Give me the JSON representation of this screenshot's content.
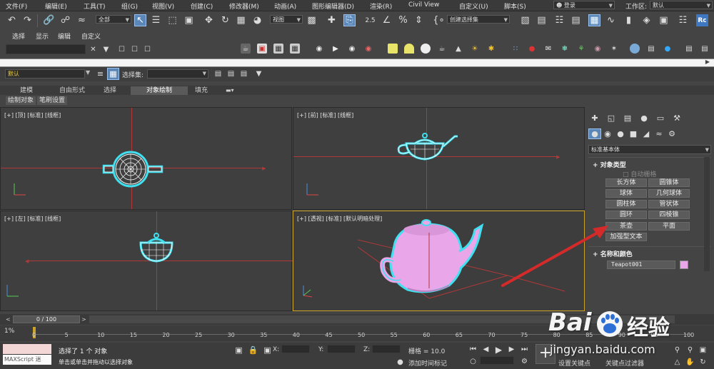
{
  "menu": {
    "items": [
      "文件(F)",
      "编辑(E)",
      "工具(T)",
      "组(G)",
      "视图(V)",
      "创建(C)",
      "修改器(M)",
      "动画(A)",
      "图形编辑器(D)",
      "渲染(R)",
      "Civil View",
      "自定义(U)",
      "脚本(S)"
    ],
    "login": "登录",
    "workspace_label": "工作区:",
    "workspace_value": "默认"
  },
  "toolbar": {
    "filter_value": "全部",
    "view_value": "视图",
    "selection_set_placeholder": "创建选择集",
    "snap_labels": [
      "2",
      "2.5"
    ]
  },
  "submenu": {
    "items": [
      "选择",
      "显示",
      "编辑",
      "自定义"
    ]
  },
  "layer": {
    "name": "默认",
    "selection_set_label": "选择集:"
  },
  "ribbon": {
    "tabs": [
      "建模",
      "自由形式",
      "选择",
      "对象绘制",
      "填充"
    ],
    "active_tab": "对象绘制",
    "subtabs": [
      "绘制对象",
      "笔刷设置"
    ]
  },
  "viewports": [
    {
      "label": "[+] [顶] [标准] [线框]"
    },
    {
      "label": "[+] [前] [标准] [线框]"
    },
    {
      "label": "[+] [左] [标准] [线框]"
    },
    {
      "label": "[+] [透视] [标准] [默认明暗处理]"
    }
  ],
  "command_panel": {
    "category": "标准基本体",
    "object_type_title": "对象类型",
    "autogrid_label": "自动栅格",
    "buttons": [
      [
        "长方体",
        "圆锥体"
      ],
      [
        "球体",
        "几何球体"
      ],
      [
        "圆柱体",
        "管状体"
      ],
      [
        "圆环",
        "四棱锥"
      ],
      [
        "茶壶",
        "平面"
      ]
    ],
    "extra_button": "加强型文本",
    "name_color_title": "名称和颜色",
    "object_name": "Teapot001",
    "object_color": "#e9a6e8"
  },
  "timeline": {
    "frame_display": "0 / 100",
    "ticks": [
      "0",
      "5",
      "10",
      "15",
      "20",
      "25",
      "30",
      "35",
      "40",
      "45",
      "50",
      "55",
      "60",
      "65",
      "70",
      "75",
      "80",
      "85",
      "90",
      "95",
      "100"
    ]
  },
  "status": {
    "script_label": "MAXScript 迷",
    "selected_text": "选择了 1 个 对象",
    "hint_text": "单击或单击并拖动以选择对象",
    "x_label": "X:",
    "y_label": "Y:",
    "z_label": "Z:",
    "grid_label": "栅格 = 10.0",
    "add_time_tag": "添加时间标记",
    "set_key": "设置关键点",
    "key_filter": "关键点过滤器"
  },
  "watermark": {
    "brand": "Bai",
    "brand_cn": "经验",
    "url": "jingyan.baidu.com"
  },
  "colors": {
    "teapot": "#e9a6e8",
    "selection_outline": "#3fe0f0",
    "accent_blue": "#5a87b8",
    "annotation_arrow": "#d42a2a",
    "active_viewport_border": "#c9a227"
  }
}
